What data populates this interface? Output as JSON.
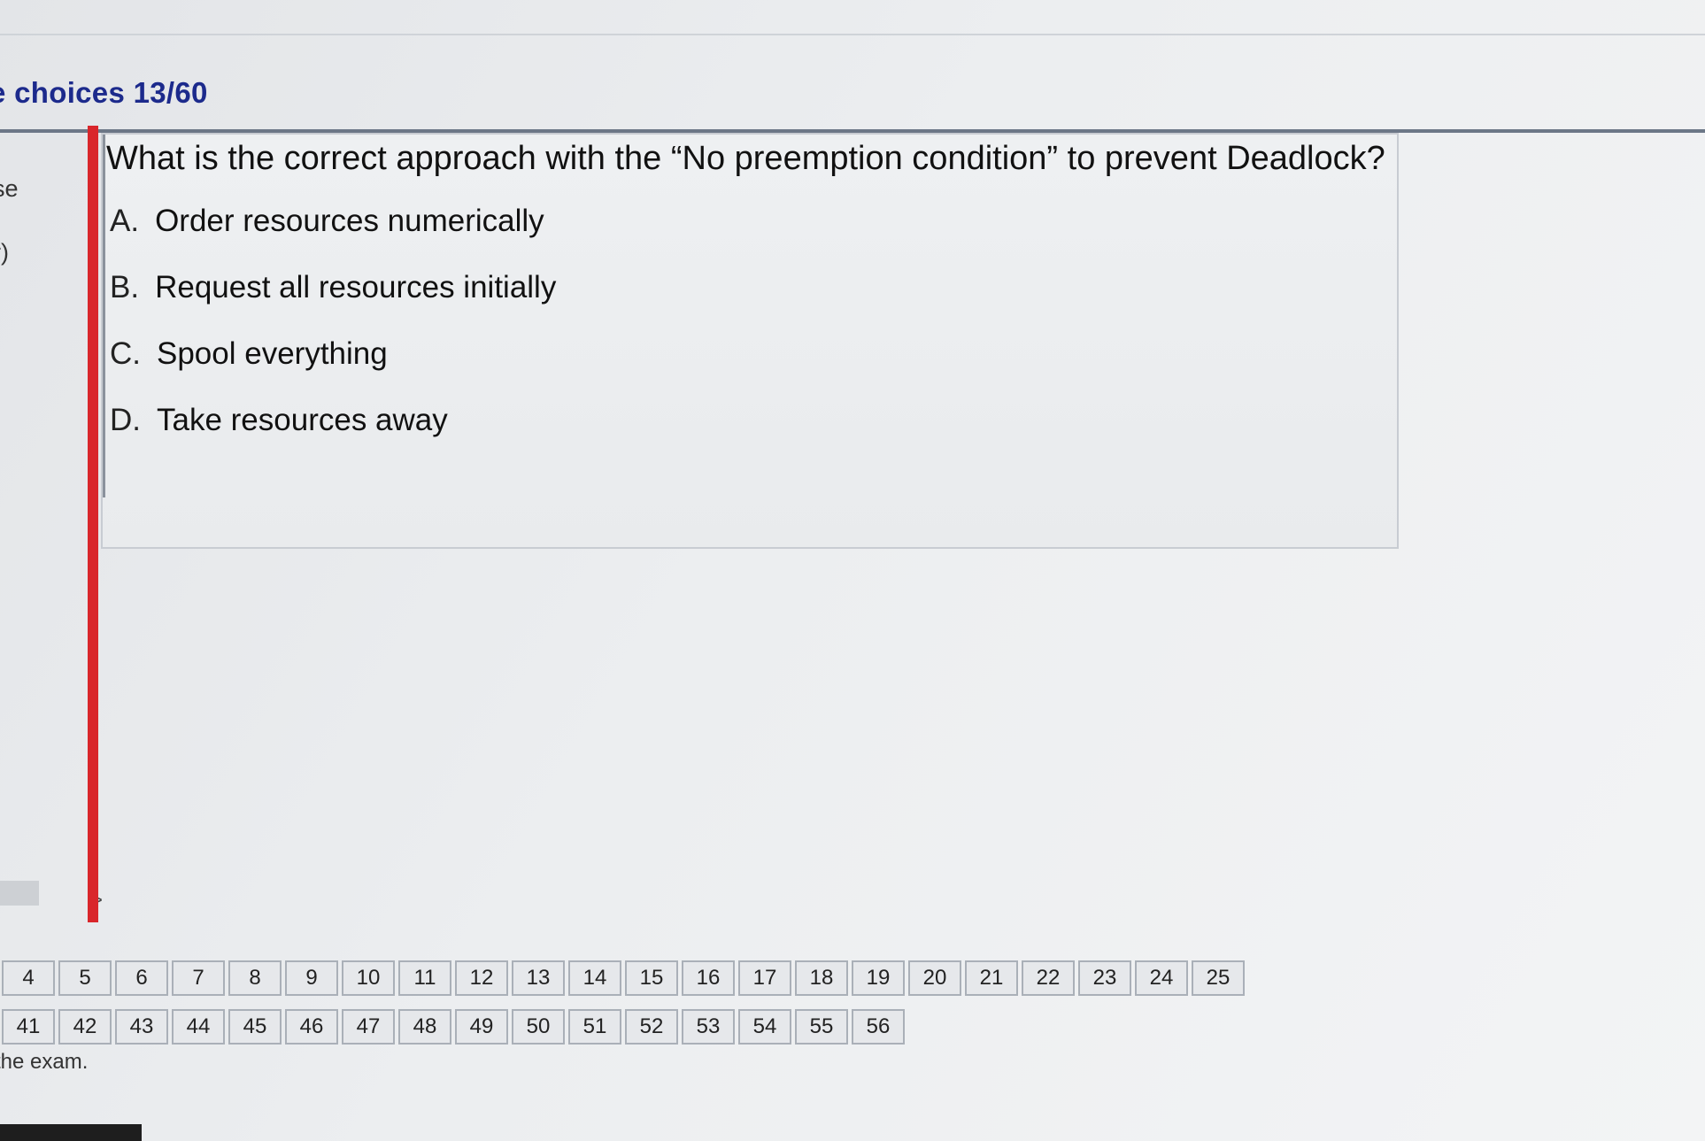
{
  "header": {
    "title": "e choices 13/60"
  },
  "left_nav": {
    "items": [
      "se",
      "r)"
    ]
  },
  "question": {
    "text": "What is the correct approach with the “No preemption condition” to prevent Deadlock?",
    "options": [
      {
        "letter": "A.",
        "text": "Order resources numerically"
      },
      {
        "letter": "B.",
        "text": "Request all resources initially"
      },
      {
        "letter": "C.",
        "text": "Spool everything"
      },
      {
        "letter": "D.",
        "text": "Take resources away"
      }
    ]
  },
  "scroll": {
    "arrow": ">"
  },
  "question_nav": {
    "row1": [
      "4",
      "5",
      "6",
      "7",
      "8",
      "9",
      "10",
      "11",
      "12",
      "13",
      "14",
      "15",
      "16",
      "17",
      "18",
      "19",
      "20",
      "21",
      "22",
      "23",
      "24",
      "25"
    ],
    "row2": [
      "41",
      "42",
      "43",
      "44",
      "45",
      "46",
      "47",
      "48",
      "49",
      "50",
      "51",
      "52",
      "53",
      "54",
      "55",
      "56"
    ]
  },
  "footer": {
    "note": "the exam."
  }
}
